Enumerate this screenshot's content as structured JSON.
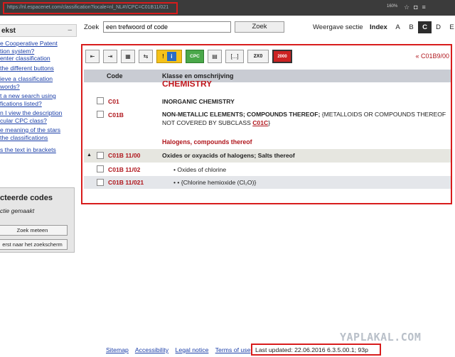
{
  "browser": {
    "url": "https://nl.espacenet.com/classification?locale=nl_NL#!/CPC=C01B11/021",
    "zoom": "160%"
  },
  "sidebar": {
    "heading": "ekst",
    "collapse_symbol": "–",
    "help_links": [
      "e Cooperative Patent\ntion system?\nenter classification",
      "the different buttons",
      "ieve a classification\nwords?",
      "t a new search using\nfications listed?",
      "n I view the description\ncular CPC class?",
      "e meaning of the stars\nthe classifications",
      "s the text in brackets"
    ],
    "codes_box": {
      "title": "cteerde codes",
      "subtitle": "ctie gemaakt",
      "button1": "Zoek meteen",
      "button2": "erst naar het zoekscherm"
    }
  },
  "search": {
    "label": "Zoek",
    "input_value": "een trefwoord of code",
    "button": "Zoek",
    "section_label": "Weergave sectie",
    "index_label": "Index",
    "letters": [
      "A",
      "B",
      "C",
      "D",
      "E"
    ],
    "active_letter": "C"
  },
  "panel": {
    "toolbar": {
      "cpc": "CPC",
      "brackets": "[...]",
      "twox": "2X0",
      "zero": "2000",
      "info": "i",
      "warn": "!"
    },
    "breadcrumb": "« C01B9/00",
    "columns": {
      "code": "Code",
      "description": "Klasse en omschrijving"
    },
    "scrolled_title": "CHEMISTRY",
    "rows": [
      {
        "code": "C01",
        "description": "INORGANIC CHEMISTRY"
      },
      {
        "code": "C01B",
        "description_bold": "NON-METALLIC ELEMENTS; COMPOUNDS THEREOF;",
        "description_rest": " {METALLOIDS OR COMPOUNDS THEREOF NOT COVERED BY SUBCLASS ",
        "ref": "C01C",
        "description_end": "}"
      },
      {
        "group_title": "Halogens, compounds thereof"
      },
      {
        "code": "C01B 11/00",
        "description": "Oxides or oxyacids of halogens; Salts thereof"
      },
      {
        "code": "C01B 11/02",
        "description": "• Oxides of chlorine"
      },
      {
        "code": "C01B 11/021",
        "description": "• • {Chlorine hemioxide (Cl₂O)}"
      }
    ]
  },
  "watermark": "YAPLAKAL.COM",
  "footer": {
    "links": [
      "Sitemap",
      "Accessibility",
      "Legal notice",
      "Terms of use"
    ],
    "updated": "Last updated: 22.06.2016   6.3.5.00.1; 93p"
  },
  "colors": {
    "highlight_border": "#d81c1c",
    "code_red": "#b0161c",
    "header_gray": "#c9ccd3",
    "active_letter_bg": "#2c2c2c"
  }
}
